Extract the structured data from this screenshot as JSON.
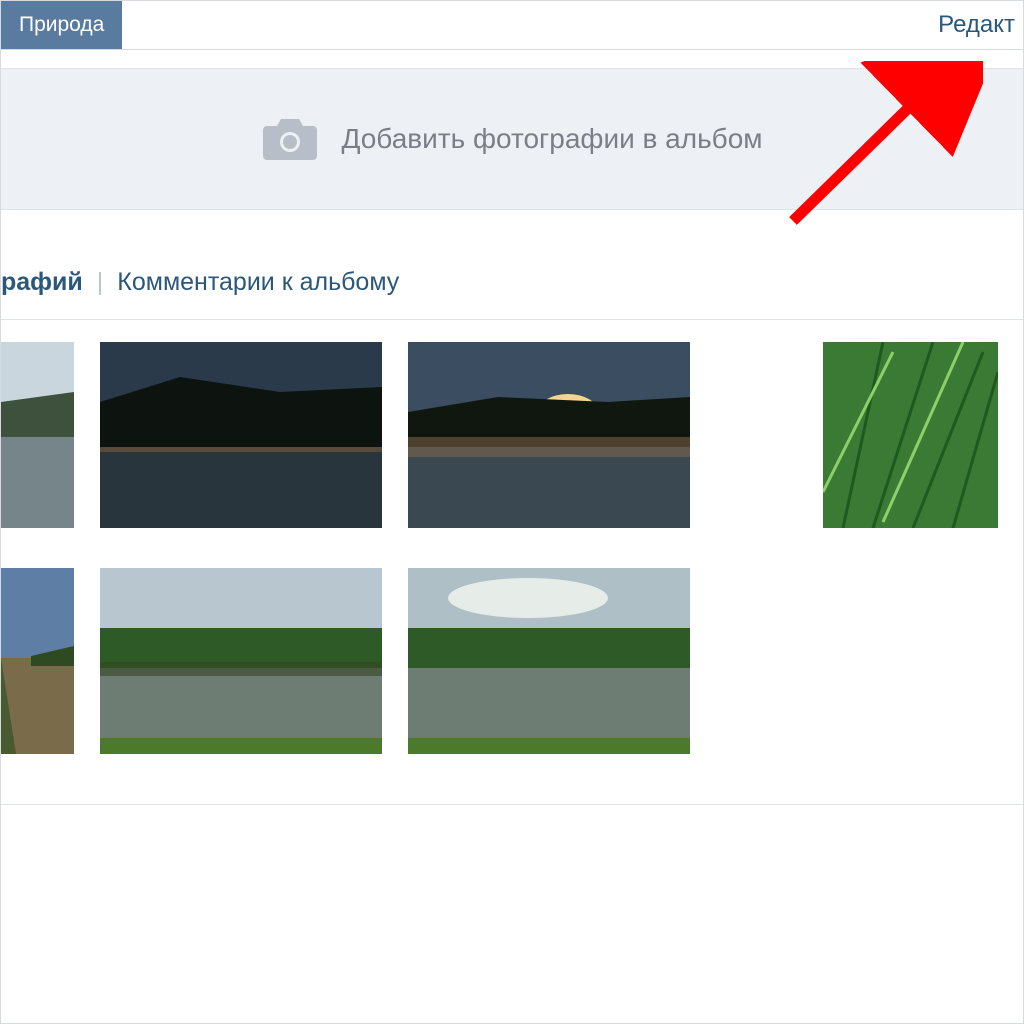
{
  "header": {
    "album_tab": "Природа",
    "edit_link": "Редакт"
  },
  "add_panel": {
    "label": "Добавить фотографии в альбом",
    "icon": "camera-icon"
  },
  "subtabs": {
    "active": "рафий",
    "separator": "|",
    "other": "Комментарии к альбому"
  },
  "photos_row1": [
    {
      "name": "photo-thumb-1"
    },
    {
      "name": "photo-thumb-2"
    },
    {
      "name": "photo-thumb-3"
    },
    {
      "name": "photo-thumb-4"
    }
  ],
  "photos_row2": [
    {
      "name": "photo-thumb-5"
    },
    {
      "name": "photo-thumb-6"
    },
    {
      "name": "photo-thumb-7"
    }
  ],
  "annotation": {
    "arrow": "arrow-icon"
  }
}
